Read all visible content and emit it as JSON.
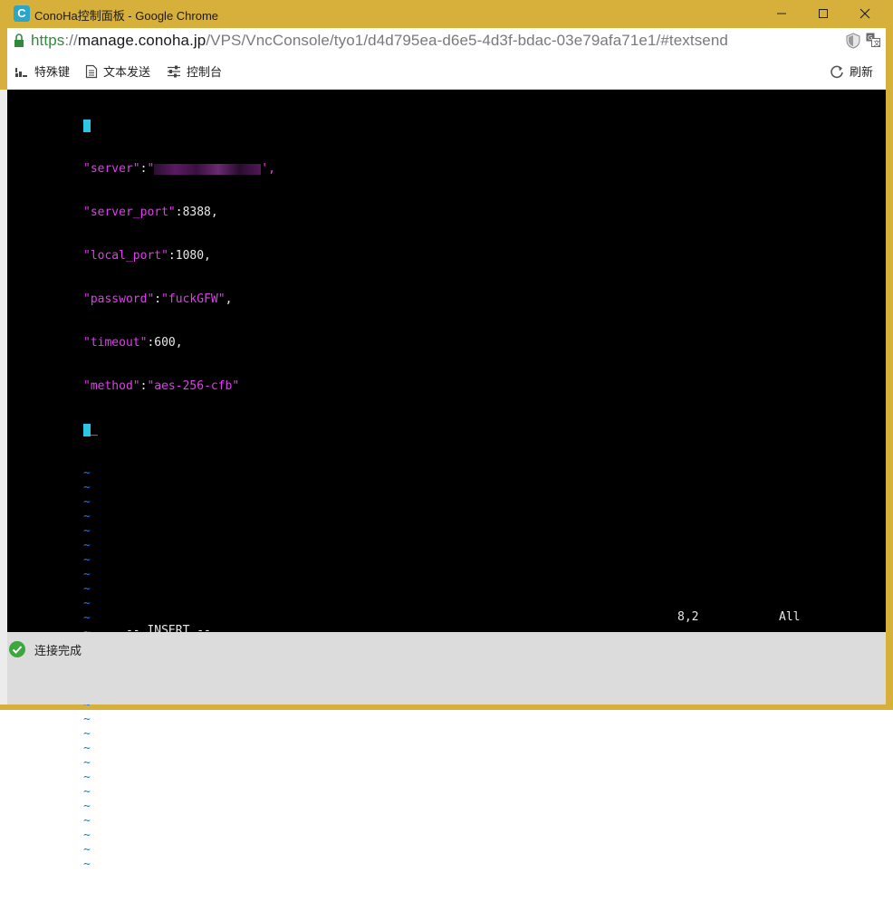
{
  "window": {
    "title": "ConoHa控制面板 - Google Chrome",
    "app_icon_letter": "C",
    "accent_color": "#d6b03a"
  },
  "address": {
    "scheme": "https",
    "separator": "://",
    "host": "manage.conoha.jp",
    "path": "/VPS/VncConsole/tyo1/d4d795ea-d6e5-4d3f-bdac-03e79afa71e1/#textsend"
  },
  "toolbar": {
    "keys_label": "特殊键",
    "send_text_label": "文本发送",
    "console_label": "控制台",
    "refresh_label": "刷新"
  },
  "console": {
    "lines": [
      {
        "key": "\"server\"",
        "sep": ":",
        "value": "\"",
        "tail": "',"
      },
      {
        "key": "\"server_port\"",
        "sep": ":",
        "value": "8388,"
      },
      {
        "key": "\"local_port\"",
        "sep": ":",
        "value": "1080,"
      },
      {
        "key": "\"password\"",
        "sep": ":",
        "value": "\"fuckGFW\"",
        "tail": ","
      },
      {
        "key": "\"timeout\"",
        "sep": ":",
        "value": "600,"
      },
      {
        "key": "\"method\"",
        "sep": ":",
        "value": "\"aes-256-cfb\""
      }
    ],
    "tilde": "~",
    "mode": "-- INSERT --",
    "position": "8,2",
    "scroll": "All",
    "colors": {
      "string": "#e23cf0",
      "text": "#e8e8e8",
      "tilde": "#2b6cf0",
      "cursor": "#2bc6e0"
    }
  },
  "status": {
    "message": "连接完成",
    "icon": "check-circle-icon"
  }
}
